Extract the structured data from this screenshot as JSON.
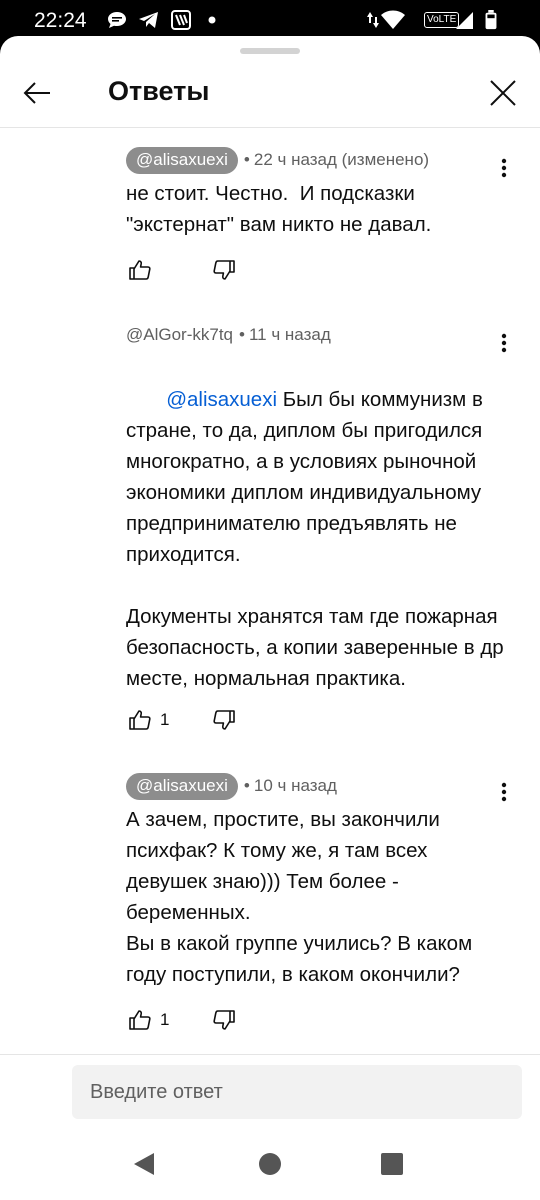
{
  "status_bar": {
    "time": "22:24",
    "volte_label": "VoLTE",
    "icons": [
      "chat-icon",
      "telegram-icon",
      "app-icon",
      "dot-icon",
      "data-arrows-icon",
      "wifi-icon",
      "volte-icon",
      "signal-icon",
      "battery-icon"
    ]
  },
  "header": {
    "title": "Ответы",
    "back_icon": "arrow-left-icon",
    "close_icon": "close-icon"
  },
  "comments": [
    {
      "handle": "@alisaxuexi",
      "handle_highlighted": true,
      "time": "22 ч назад (изменено)",
      "text": "не стоит. Честно.  И подсказки \"экстернат\" вам никто не давал.",
      "likes": ""
    },
    {
      "handle": "@AlGor-kk7tq",
      "handle_highlighted": false,
      "time": "11 ч назад",
      "mention": "@alisaxuexi",
      "text": " Был бы коммунизм в стране, то да, диплом бы пригодился многократно, а в условиях рыночной экономики диплом индивидуальному предпринимателю предъявлять не приходится.\n\nДокументы хранятся там где пожарная безопасность, а копии заверенные в др месте, нормальная практика.",
      "likes": "1"
    },
    {
      "handle": "@alisaxuexi",
      "handle_highlighted": true,
      "time": "10 ч назад",
      "text": "А зачем, простите, вы закончили психфак? К тому же, я там всех девушек знаю))) Тем более - беременных.\nВы в какой группе учились? В каком году поступили, в каком окончили?",
      "likes": "1"
    }
  ],
  "reply": {
    "placeholder": "Введите ответ"
  },
  "nav": {
    "icons": [
      "back-triangle-icon",
      "home-circle-icon",
      "recents-square-icon"
    ]
  },
  "colors": {
    "mention": "#065fd4",
    "chip": "#8d8d8d",
    "meta": "#606060",
    "text": "#0f0f0f"
  }
}
